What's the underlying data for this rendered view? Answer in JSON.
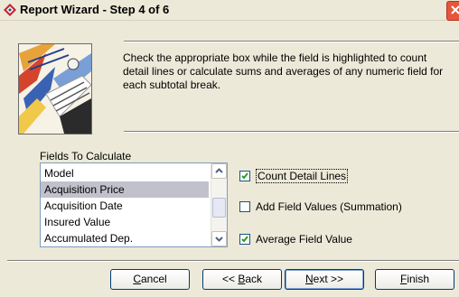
{
  "window": {
    "title": "Report Wizard - Step 4 of 6"
  },
  "header": {
    "description": "Check the appropriate box while the field is highlighted to count detail lines or calculate sums and averages of any numeric field for each subtotal break."
  },
  "fields": {
    "label": "Fields To Calculate",
    "items": [
      {
        "label": "Model",
        "selected": false
      },
      {
        "label": "Acquisition Price",
        "selected": true
      },
      {
        "label": "Acquisition Date",
        "selected": false
      },
      {
        "label": "Insured Value",
        "selected": false
      },
      {
        "label": "Accumulated Dep.",
        "selected": false
      }
    ]
  },
  "options": {
    "count_detail_lines": {
      "label": "Count Detail Lines",
      "checked": true
    },
    "add_field_values": {
      "label": "Add Field Values (Summation)",
      "checked": false
    },
    "average_field_value": {
      "label": "Average Field Value",
      "checked": true
    }
  },
  "buttons": {
    "cancel": {
      "mnemonic": "C",
      "rest": "ancel"
    },
    "back": {
      "pre": "<< ",
      "mnemonic": "B",
      "rest": "ack"
    },
    "next": {
      "mnemonic": "N",
      "rest": "ext >>"
    },
    "finish": {
      "mnemonic": "F",
      "rest": "inish"
    }
  },
  "colors": {
    "window_bg": "#ece9d8",
    "selection": "#c1c1cc",
    "button_border": "#003c74",
    "check_mark": "#21a121",
    "close_button": "#e5563b"
  }
}
